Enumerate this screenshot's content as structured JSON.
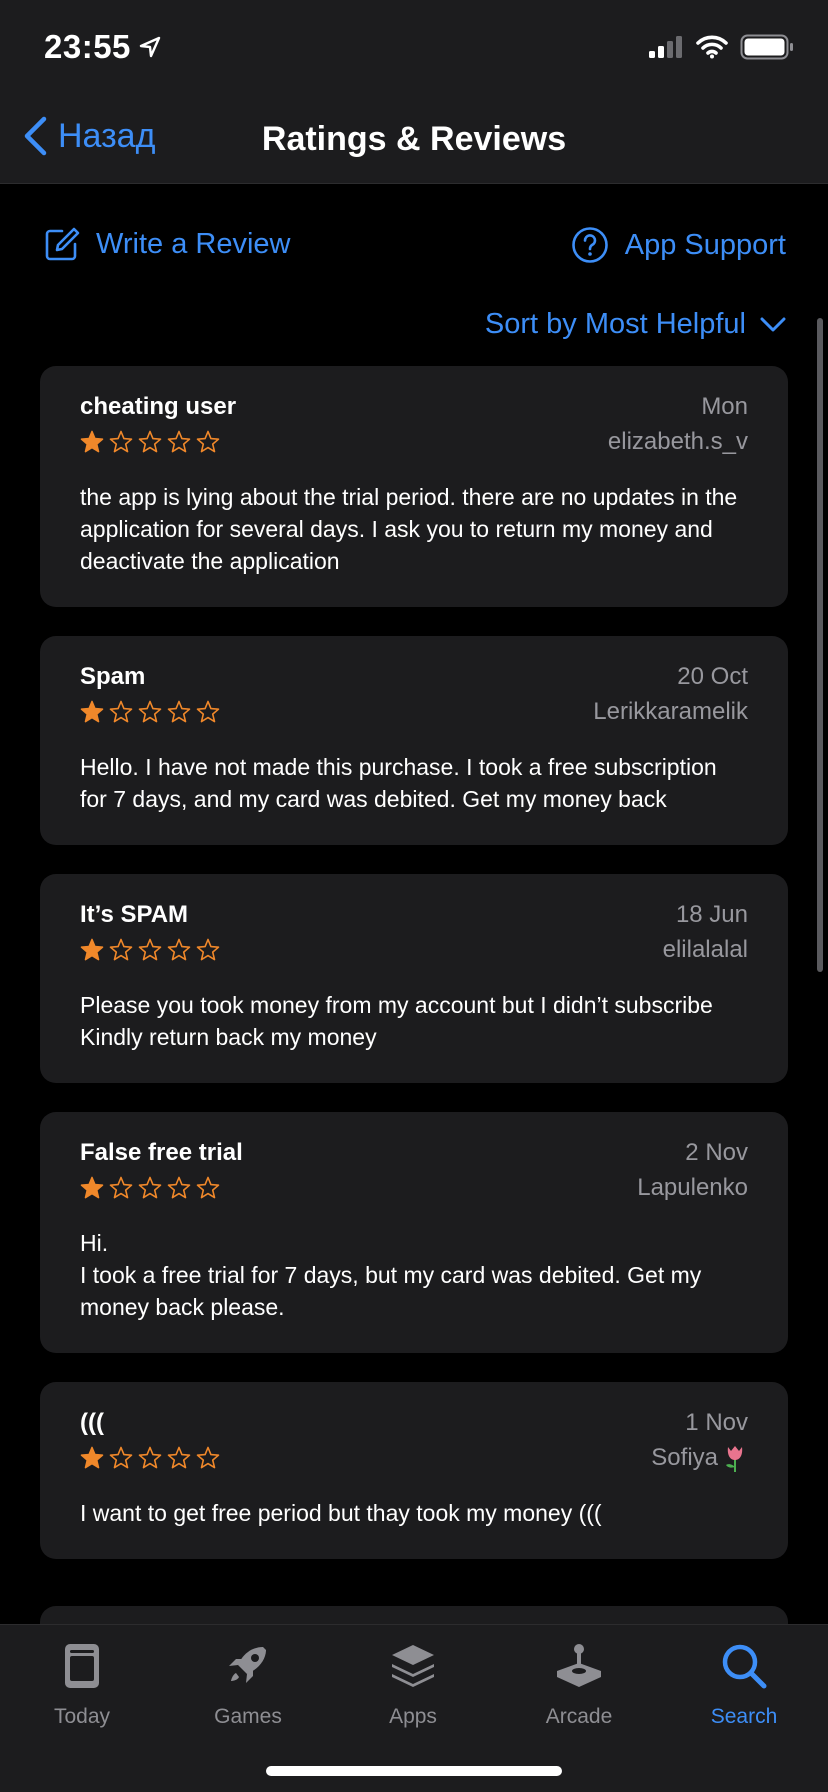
{
  "status_bar": {
    "time": "23:55"
  },
  "nav": {
    "back_label": "Назад",
    "title": "Ratings & Reviews"
  },
  "actions": {
    "write_review": "Write a Review",
    "app_support": "App Support"
  },
  "sort": {
    "label": "Sort by Most Helpful"
  },
  "colors": {
    "accent": "#3d8ef7",
    "star": "#f0882a",
    "card_bg": "#1c1c1e",
    "secondary_text": "#98989e"
  },
  "reviews": [
    {
      "title": "cheating user",
      "date": "Mon",
      "author": "elizabeth.s_v",
      "rating": 1,
      "body": "the app is lying about the trial period.  there are no updates in the application for several days.  I ask you to return my money and deactivate the application"
    },
    {
      "title": "Spam",
      "date": "20 Oct",
      "author": "Lerikkaramelik",
      "rating": 1,
      "body": "Hello.  I have not made this purchase.  I took a free subscription for 7 days, and my card was debited. Get my money back"
    },
    {
      "title": "It’s SPAM",
      "date": "18 Jun",
      "author": "elilalalal",
      "rating": 1,
      "body": "Please you took money from my account but I didn’t subscribe\nKindly return back my money"
    },
    {
      "title": "False free trial",
      "date": "2 Nov",
      "author": "Lapulenko",
      "rating": 1,
      "body": "Hi.\nI took a free trial for 7 days, but my card was debited. Get my money back please."
    },
    {
      "title": "(((",
      "date": "1 Nov",
      "author": "Sofiya",
      "author_emoji": "tulip-icon",
      "rating": 1,
      "body": "I want to get free period but thay took my money ((("
    }
  ],
  "tabs": [
    {
      "label": "Today",
      "icon": "today-icon",
      "active": false
    },
    {
      "label": "Games",
      "icon": "rocket-icon",
      "active": false
    },
    {
      "label": "Apps",
      "icon": "layers-icon",
      "active": false
    },
    {
      "label": "Arcade",
      "icon": "joystick-icon",
      "active": false
    },
    {
      "label": "Search",
      "icon": "search-icon",
      "active": true
    }
  ]
}
